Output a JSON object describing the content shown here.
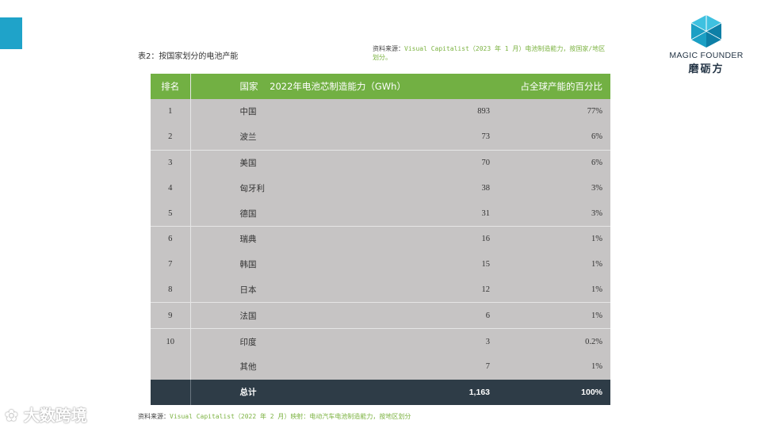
{
  "title": "表2：按国家划分的电池产能",
  "source_top": {
    "label": "资料来源：",
    "text": "Visual Capitalist（2023 年 1 月）电池制造能力，按国家/地区划分。"
  },
  "logo": {
    "en": "MAGIC FOUNDER",
    "cn": "磨砺方"
  },
  "table": {
    "headers": {
      "rank": "排名",
      "country": "国家",
      "capacity": "2022年电池芯制造能力（GWh）",
      "share": "占全球产能的百分比"
    },
    "rows": [
      {
        "rank": "1",
        "country": "中国",
        "capacity": "893",
        "share": "77%"
      },
      {
        "rank": "2",
        "country": "波兰",
        "capacity": "73",
        "share": "6%"
      },
      {
        "rank": "3",
        "country": "美国",
        "capacity": "70",
        "share": "6%"
      },
      {
        "rank": "4",
        "country": "匈牙利",
        "capacity": "38",
        "share": "3%"
      },
      {
        "rank": "5",
        "country": "德国",
        "capacity": "31",
        "share": "3%"
      },
      {
        "rank": "6",
        "country": "瑞典",
        "capacity": "16",
        "share": "1%"
      },
      {
        "rank": "7",
        "country": "韩国",
        "capacity": "15",
        "share": "1%"
      },
      {
        "rank": "8",
        "country": "日本",
        "capacity": "12",
        "share": "1%"
      },
      {
        "rank": "9",
        "country": "法国",
        "capacity": "6",
        "share": "1%"
      },
      {
        "rank": "10",
        "country": "印度",
        "capacity": "3",
        "share": "0.2%"
      },
      {
        "rank": "",
        "country": "其他",
        "capacity": "7",
        "share": "1%"
      }
    ],
    "total": {
      "label": "总计",
      "capacity": "1,163",
      "share": "100%"
    }
  },
  "source_bottom": {
    "label": "资料来源：",
    "text": "Visual Capitalist（2022 年 2 月）映射：电动汽车电池制造能力，按地区划分"
  },
  "watermark": "大数跨境",
  "colors": {
    "header_green": "#72b043",
    "row_gray": "#c6c4c4",
    "total_dark": "#2e3c47",
    "accent_blue": "#1fa3c9",
    "source_green": "#7cb342"
  }
}
